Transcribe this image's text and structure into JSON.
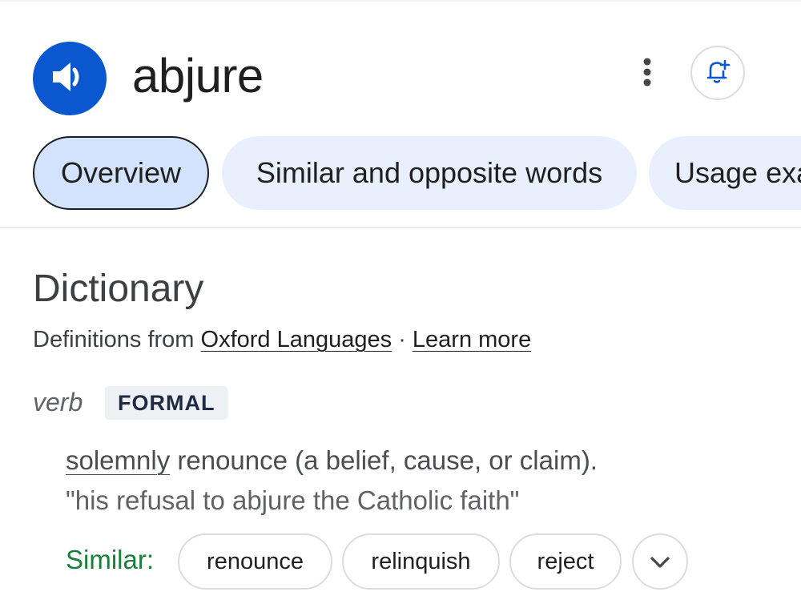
{
  "header": {
    "word": "abjure",
    "speaker_icon": "speaker-icon",
    "more_icon": "more-vert-icon",
    "bell_icon": "bell-add-icon",
    "accent": "#0b57d0"
  },
  "tabs": [
    {
      "label": "Overview",
      "active": true
    },
    {
      "label": "Similar and opposite words",
      "active": false
    },
    {
      "label": "Usage examples",
      "active": false
    }
  ],
  "dictionary": {
    "title": "Dictionary",
    "source_prefix": "Definitions from ",
    "source_link": "Oxford Languages",
    "separator": " · ",
    "learn_more": "Learn more",
    "part_of_speech": "verb",
    "register": "FORMAL",
    "definition_link": "solemnly",
    "definition_rest": " renounce (a belief, cause, or claim).",
    "example": "\"his refusal to abjure the Catholic faith\"",
    "similar_label": "Similar:",
    "similar_words": [
      "renounce",
      "relinquish",
      "reject"
    ],
    "expand_icon": "chevron-down-icon",
    "similar_color": "#188038"
  }
}
